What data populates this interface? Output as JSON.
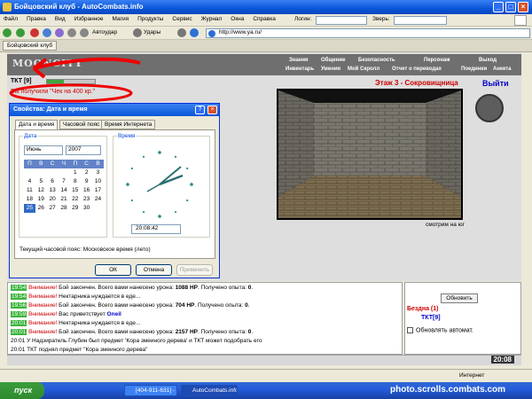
{
  "window": {
    "title": "Бойцовский клуб - AutoCombats.info"
  },
  "menu": [
    "Файл",
    "Правка",
    "Вид",
    "Избранное",
    "Магия",
    "Продукты",
    "Сервис",
    "Журнал",
    "Окна",
    "Справка"
  ],
  "login_label": "Логин:",
  "beast_label": "Зверь:",
  "toolbar": {
    "autoattack": "Автоудар",
    "strikes": "Удары",
    "address": "http://www.ya.ru/"
  },
  "tab": "Бойцовский клуб",
  "game": {
    "logo": "MOONCITY",
    "nav_top": [
      "Знания",
      "Общение",
      "Безопасность",
      "Персонаж",
      "Выход"
    ],
    "nav_bottom": [
      "Инвентарь",
      "Умения",
      "Мой Скролл",
      "Отчет о переводах",
      "Поединки",
      "Анкета"
    ],
    "player": "ТКТ [9]",
    "hp_fraction": 0.35,
    "cheque": "Вы получили \"Чек на 400 кр.\"",
    "location": "Этаж 3 - Сокровищница",
    "exit": "Выйти",
    "view_caption": "смотрим на юг"
  },
  "dialog": {
    "title": "Свойства: Дата и время",
    "tabs": [
      "Дата и время",
      "Часовой пояс",
      "Время Интернета"
    ],
    "date_label": "Дата",
    "time_label": "Время",
    "month": "Июнь",
    "year": "2007",
    "weekdays": [
      "П",
      "В",
      "С",
      "Ч",
      "П",
      "С",
      "В"
    ],
    "weeks": [
      [
        "",
        "",
        "",
        "",
        "1",
        "2",
        "3"
      ],
      [
        "4",
        "5",
        "6",
        "7",
        "8",
        "9",
        "10"
      ],
      [
        "11",
        "12",
        "13",
        "14",
        "15",
        "16",
        "17"
      ],
      [
        "18",
        "19",
        "20",
        "21",
        "22",
        "23",
        "24"
      ],
      [
        "25",
        "26",
        "27",
        "28",
        "29",
        "30",
        ""
      ]
    ],
    "selected_day": "25",
    "time": "20:08:42",
    "timezone": "Текущий часовой пояс: Московское время (лето)",
    "ok": "ОК",
    "cancel": "Отмена",
    "apply": "Применить"
  },
  "chat": [
    {
      "time": "19:54",
      "warn": "Внимание!",
      "text": " Бой закончен. Всего вами нанесено урона: ",
      "hp": "1088 HP",
      "text2": ". Получено опыта: ",
      "exp": "0",
      "end": "."
    },
    {
      "time": "19:54",
      "warn": "Внимание!",
      "text": " Нектарника нуждается в еде...",
      "hp": "",
      "text2": "",
      "exp": "",
      "end": ""
    },
    {
      "time": "19:56",
      "warn": "Внимание!",
      "text": " Бой закончен. Всего вами нанесено урона: ",
      "hp": "704 HP",
      "text2": ". Получено опыта: ",
      "exp": "0",
      "end": "."
    },
    {
      "time": "19:59",
      "warn": "Внимание!",
      "text": " Вас приветствует ",
      "hp": "Oneil",
      "text2": "",
      "exp": "",
      "end": ""
    },
    {
      "time": "20:01",
      "warn": "Внимание!",
      "text": " Нектарника нуждается в еде...",
      "hp": "",
      "text2": "",
      "exp": "",
      "end": ""
    },
    {
      "time": "20:01",
      "warn": "Внимание!",
      "text": " Бой закончен. Всего вами нанесено урона: ",
      "hp": "2157 HP",
      "text2": ". Получено опыта: ",
      "exp": "0",
      "end": "."
    },
    {
      "time": "20:01",
      "warn": "",
      "text": "У Надзиратель Глубин был предмет 'Кора змеиного дерева' и ТКТ может подобрать его",
      "hp": "",
      "text2": "",
      "exp": "",
      "end": ""
    },
    {
      "time": "20:01",
      "warn": "",
      "text": "ТКТ поднял предмет \"Кора змеиного дерева\"",
      "hp": "",
      "text2": "",
      "exp": "",
      "end": ""
    }
  ],
  "room": {
    "refresh": "Обновить",
    "location": "Бездна (1)",
    "player": "ТКТ[9]",
    "auto_refresh": "Обновлять автомат."
  },
  "game_time": "20:08",
  "status": {
    "zone": "Интернет"
  },
  "taskbar": {
    "start": "пуск",
    "tasks": [
      "[404-911-631] - Огн...",
      "AutoCombats.info"
    ]
  },
  "watermark": "photo.scrolls.combats.com"
}
